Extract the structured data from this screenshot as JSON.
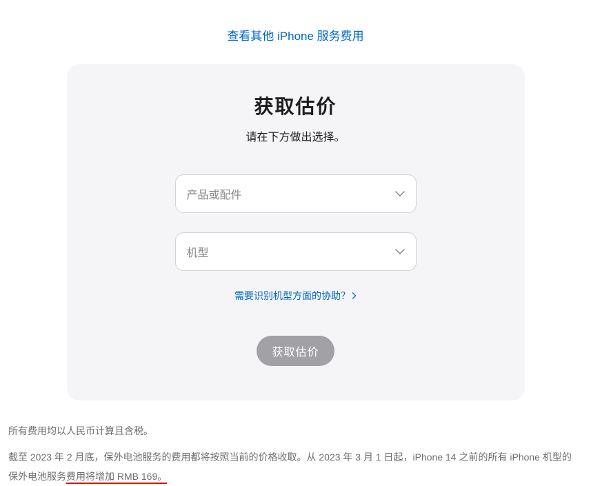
{
  "topLink": {
    "label": "查看其他 iPhone 服务费用"
  },
  "card": {
    "title": "获取估价",
    "subtitle": "请在下方做出选择。",
    "select1": {
      "placeholder": "产品或配件"
    },
    "select2": {
      "placeholder": "机型"
    },
    "helpLink": {
      "label": "需要识别机型方面的协助？"
    },
    "submitButton": {
      "label": "获取估价"
    }
  },
  "footnote": {
    "line1": "所有费用均以人民币计算且含税。",
    "line2a": "截至 2023 年 2 月底，保外电池服务的费用都将按照当前的价格收取。从 2023 年 3 月 1 日起，iPhone 14 之前的所有 iPhone 机型的保外电池服务",
    "line2b": "费用将增加 RMB 169。"
  }
}
